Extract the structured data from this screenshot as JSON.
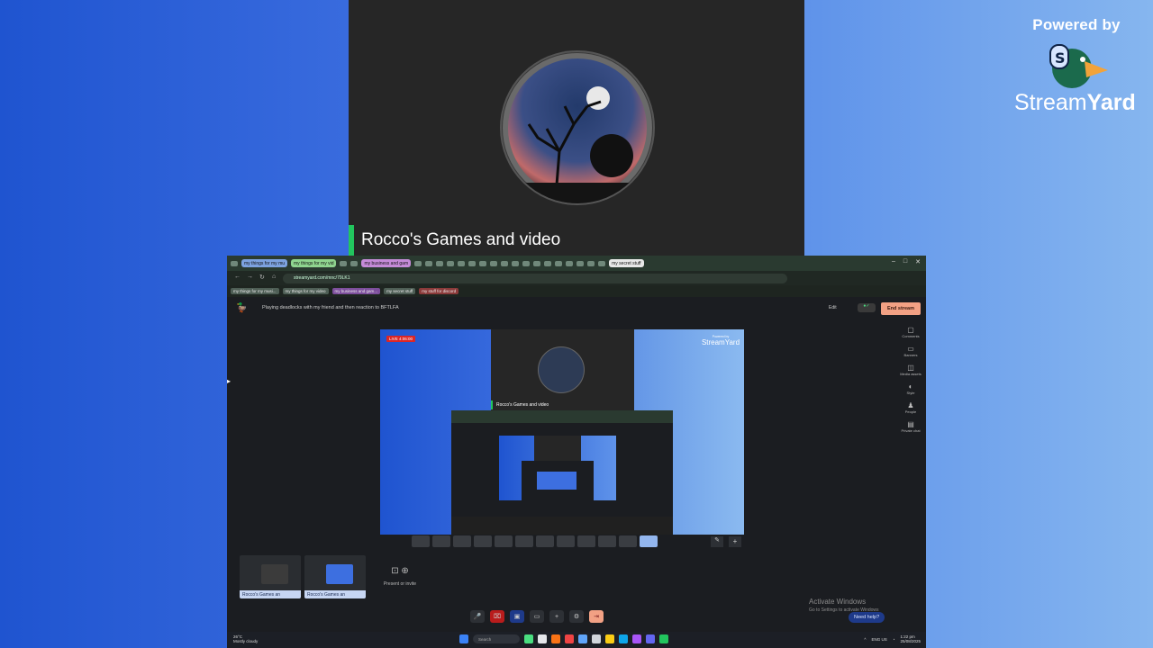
{
  "stream": {
    "presenter_name": "Rocco's Games and video",
    "powered_by": "Powered by",
    "brand_name_a": "Stream",
    "brand_name_b": "Yard"
  },
  "browser": {
    "tabs": [
      "my things for my mu",
      "my things for my vid",
      "my business and gam",
      "my secret stuff"
    ],
    "url": "streamyard.com/mnc/79LK1",
    "bookmarks": [
      "my things for my musi...",
      "my things for my video",
      "my business and gam...",
      "my secret stuff",
      "my stuff for discord"
    ]
  },
  "studio": {
    "broadcast_title": "Playing deadlocks with my friend and then reaction to BFTLFA",
    "edit_label": "Edit",
    "end_stream_label": "End stream",
    "live_badge": "LIVE 4:06:00",
    "right_rail": [
      "Comments",
      "Banners",
      "Media assets",
      "Style",
      "People",
      "Private chat"
    ],
    "guests": [
      "Rocco's Games an",
      "Rocco's Games an"
    ],
    "present_label": "Present or invite",
    "activate_title": "Activate Windows",
    "activate_sub": "Go to Settings to activate Windows",
    "help_label": "Need help?"
  },
  "taskbar": {
    "temp": "26°C",
    "weather": "Mostly cloudy",
    "search_placeholder": "Search",
    "lang": "ENG US",
    "time": "1:22 pm",
    "date": "25/08/2025"
  }
}
